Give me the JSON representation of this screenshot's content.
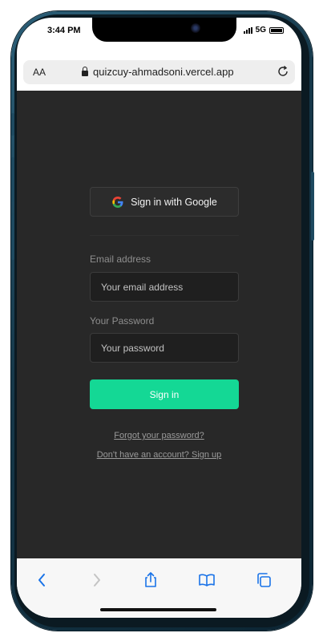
{
  "status_bar": {
    "time": "3:44 PM",
    "network": "5G"
  },
  "browser": {
    "reader_label": "AA",
    "url": "quizcuy-ahmadsoni.vercel.app"
  },
  "auth": {
    "google_button": "Sign in with Google",
    "email_label": "Email address",
    "email_placeholder": "Your email address",
    "password_label": "Your Password",
    "password_placeholder": "Your password",
    "signin_button": "Sign in",
    "forgot_link": "Forgot your password?",
    "signup_link": "Don't have an account? Sign up"
  },
  "colors": {
    "accent": "#14d895",
    "background": "#282828",
    "browser_icon": "#1a73e8"
  },
  "toolbar": {
    "icons": [
      "back-icon",
      "forward-icon",
      "share-icon",
      "bookmarks-icon",
      "tabs-icon"
    ]
  }
}
